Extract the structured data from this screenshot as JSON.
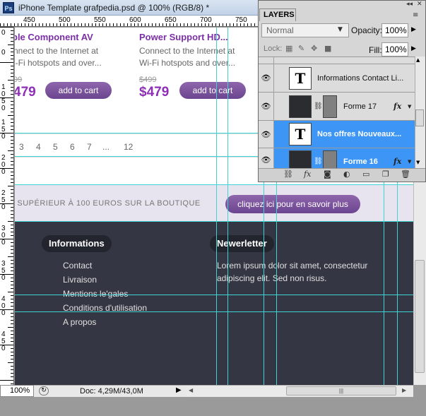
{
  "window": {
    "title": "iPhone Template grafpedia.psd @ 100% (RGB/8) *",
    "app_icon": "Ps"
  },
  "ruler": {
    "h_numbers": [
      "450",
      "500",
      "550",
      "600",
      "650",
      "700",
      "750"
    ],
    "v_numbers": [
      [
        "0"
      ],
      [
        "0"
      ],
      [
        "1",
        "0",
        "5",
        "0"
      ],
      [
        "1",
        "5",
        "0"
      ],
      [
        "2",
        "0",
        "0"
      ],
      [
        "2",
        "5",
        "0"
      ],
      [
        "3",
        "0",
        "0"
      ],
      [
        "3",
        "5",
        "0"
      ],
      [
        "4",
        "0",
        "0"
      ],
      [
        "4",
        "5",
        "0"
      ]
    ]
  },
  "products": [
    {
      "title": "ple Component AV",
      "desc_line1": "nnect to the Internet at",
      "desc_line2": "i-Fi hotspots and over...",
      "old_price": "99",
      "price": "479",
      "button": "add to cart"
    },
    {
      "title": "Power Support HD...",
      "desc_line1": "Connect to the Internet at",
      "desc_line2": "Wi-Fi hotspots and over...",
      "old_price": "$499",
      "price": "$479",
      "button": "add to cart"
    }
  ],
  "pagination": [
    "3",
    "4",
    "5",
    "6",
    "7",
    "...",
    "12"
  ],
  "promo": {
    "text": "E SUPÉRIEUR À 100 EUROS SUR LA BOUTIQUE",
    "button": "cliquez ici pour en savoir plus"
  },
  "footer": {
    "info_title": "Informations",
    "links": [
      "Contact",
      "Livraison",
      "Mentions le'gales",
      "Conditions d'utilisation",
      "A propos"
    ],
    "news_title": "Newerletter",
    "news_text": "Lorem ipsum dolor sit amet, consectetur adipiscing elit. Sed non risus."
  },
  "status": {
    "zoom": "100%",
    "doc_info": "Doc: 4,29M/43,0M"
  },
  "layers_panel": {
    "tab": "LAYERS",
    "blend_mode": "Normal",
    "opacity_label": "Opacity:",
    "opacity": "100%",
    "lock_label": "Lock:",
    "fill_label": "Fill:",
    "fill": "100%",
    "layers": [
      {
        "name": "Informations Contact Li...",
        "type": "text",
        "selected": false
      },
      {
        "name": "Forme 17",
        "type": "shape",
        "selected": false,
        "fx": "fx"
      },
      {
        "name": "Nos offres Nouveaux...",
        "type": "text",
        "selected": true
      },
      {
        "name": "Forme 16",
        "type": "shape",
        "selected": true,
        "fx": "fx"
      }
    ]
  },
  "colors": {
    "accent_purple": "#7b2fa8",
    "guide_cyan": "#3fd4d4",
    "footer_bg": "#343643",
    "layer_selected": "#3d96f5"
  }
}
